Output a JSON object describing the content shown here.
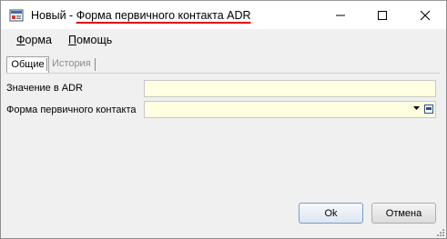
{
  "window": {
    "title_prefix": "Новый - ",
    "title_main": "Форма первичного контакта ADR"
  },
  "controls": {
    "minimize_icon": "minimize-icon",
    "maximize_icon": "maximize-icon",
    "close_icon": "close-icon"
  },
  "menu": {
    "forma_accel": "Ф",
    "forma_rest": "орма",
    "help_accel": "П",
    "help_rest": "омощь"
  },
  "tabs": [
    {
      "label": "Общие",
      "active": true
    },
    {
      "label": "История",
      "active": false
    }
  ],
  "form": {
    "adr_label": "Значение в ADR",
    "adr_value": "",
    "contact_label": "Форма первичного контакта",
    "contact_value": ""
  },
  "buttons": {
    "ok": "Ok",
    "cancel": "Отмена"
  },
  "colors": {
    "input_background": "#ffffe1",
    "title_underline": "#e3001b",
    "ok_border": "#7a9bc4"
  }
}
